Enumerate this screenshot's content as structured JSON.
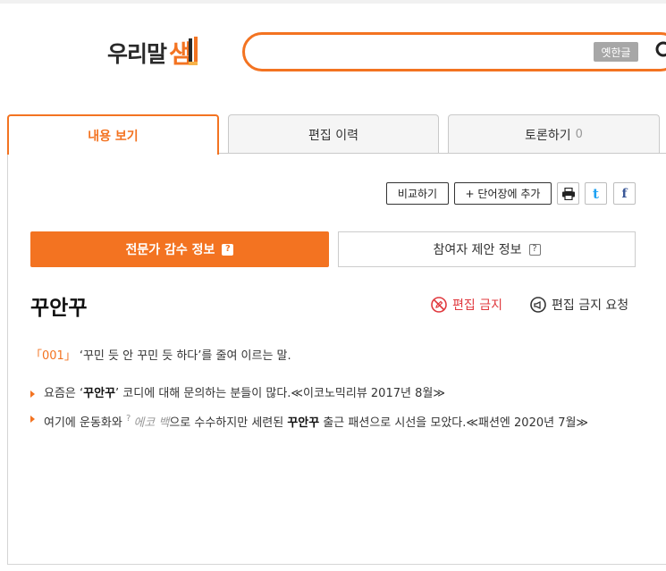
{
  "header": {
    "logo_text": "우리말",
    "logo_mark": "샘",
    "search_value": "",
    "search_placeholder": "",
    "old_hangul_label": "옛한글"
  },
  "tabs": [
    {
      "label": "내용 보기",
      "active": true
    },
    {
      "label": "편집 이력",
      "active": false
    },
    {
      "label": "토론하기",
      "count": "0",
      "active": false
    }
  ],
  "toolbar": {
    "compare_label": "비교하기",
    "add_wordbook_label": "+ 단어장에 추가",
    "print_icon": "print-icon",
    "twitter_glyph": "t",
    "facebook_glyph": "f"
  },
  "info_tabs": {
    "expert": {
      "label": "전문가 감수 정보",
      "help": "?"
    },
    "participant": {
      "label": "참여자 제안 정보",
      "help": "?"
    }
  },
  "entry": {
    "headword": "꾸안꾸",
    "edit_ban_label": "편집 금지",
    "edit_request_label": "편집 금지 요청",
    "definition": {
      "number": "「001」",
      "text": "‘꾸민 듯 안 꾸민 듯 하다’를 줄여 이르는 말."
    },
    "examples": [
      {
        "pre": "요즘은 ‘",
        "word": "꾸안꾸",
        "post": "’ 코디에 대해 문의하는 분들이 많다.≪이코노믹리뷰 2017년 8월≫"
      },
      {
        "pre": "여기에 운동화와 ",
        "sup": "?",
        "ital": "에코 백",
        "mid": "으로 수수하지만 세련된 ",
        "word": "꾸안꾸",
        "post": " 출근 패션으로 시선을 모았다.≪패션엔 2020년 7월≫"
      }
    ]
  },
  "colors": {
    "accent": "#f37321",
    "edit_ban": "#e0393e",
    "twitter": "#1da1f2",
    "facebook": "#3b5998"
  }
}
